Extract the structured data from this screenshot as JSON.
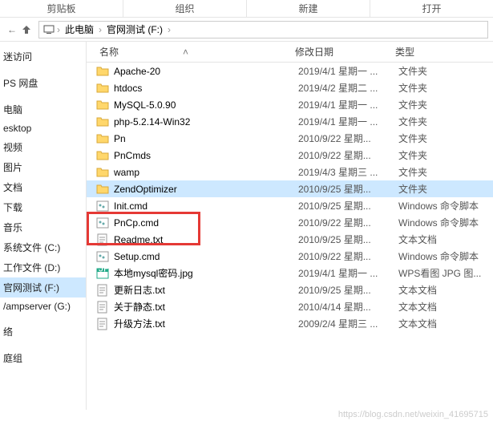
{
  "ribbon": {
    "clipboard": "剪贴板",
    "organize": "组织",
    "new": "新建",
    "open": "打开"
  },
  "nav": {
    "back": "←",
    "fwd": "→"
  },
  "breadcrumbs": [
    "此电脑",
    "官网测试 (F:)"
  ],
  "columns": {
    "name": "名称",
    "date": "修改日期",
    "type": "类型"
  },
  "sidebar": [
    {
      "label": "迷访问"
    },
    {
      "label": "PS 网盘"
    },
    {
      "label": "电脑"
    },
    {
      "label": "esktop"
    },
    {
      "label": "视频"
    },
    {
      "label": "图片"
    },
    {
      "label": "文档"
    },
    {
      "label": "下载"
    },
    {
      "label": "音乐"
    },
    {
      "label": "系统文件 (C:)"
    },
    {
      "label": "工作文件 (D:)"
    },
    {
      "label": "官网测试 (F:)",
      "selected": true
    },
    {
      "label": "/ampserver (G:)"
    },
    {
      "label": "络"
    },
    {
      "label": "庭组"
    }
  ],
  "files": [
    {
      "icon": "folder",
      "name": "Apache-20",
      "date": "2019/4/1 星期一 ...",
      "type": "文件夹"
    },
    {
      "icon": "folder",
      "name": "htdocs",
      "date": "2019/4/2 星期二 ...",
      "type": "文件夹"
    },
    {
      "icon": "folder",
      "name": "MySQL-5.0.90",
      "date": "2019/4/1 星期一 ...",
      "type": "文件夹"
    },
    {
      "icon": "folder",
      "name": "php-5.2.14-Win32",
      "date": "2019/4/1 星期一 ...",
      "type": "文件夹"
    },
    {
      "icon": "folder",
      "name": "Pn",
      "date": "2010/9/22 星期...",
      "type": "文件夹"
    },
    {
      "icon": "folder",
      "name": "PnCmds",
      "date": "2010/9/22 星期...",
      "type": "文件夹"
    },
    {
      "icon": "folder",
      "name": "wamp",
      "date": "2019/4/3 星期三 ...",
      "type": "文件夹"
    },
    {
      "icon": "folder",
      "name": "ZendOptimizer",
      "date": "2010/9/25 星期...",
      "type": "文件夹",
      "selected": true
    },
    {
      "icon": "cmd",
      "name": "Init.cmd",
      "date": "2010/9/25 星期...",
      "type": "Windows 命令脚本"
    },
    {
      "icon": "cmd",
      "name": "PnCp.cmd",
      "date": "2010/9/22 星期...",
      "type": "Windows 命令脚本"
    },
    {
      "icon": "txt",
      "name": "Readme.txt",
      "date": "2010/9/25 星期...",
      "type": "文本文档"
    },
    {
      "icon": "cmd",
      "name": "Setup.cmd",
      "date": "2010/9/22 星期...",
      "type": "Windows 命令脚本"
    },
    {
      "icon": "jpg",
      "name": "本地mysql密码.jpg",
      "date": "2019/4/1 星期一 ...",
      "type": "WPS看图 JPG 图..."
    },
    {
      "icon": "txt",
      "name": "更新日志.txt",
      "date": "2010/9/25 星期...",
      "type": "文本文档"
    },
    {
      "icon": "txt",
      "name": "关于静态.txt",
      "date": "2010/4/14 星期...",
      "type": "文本文档"
    },
    {
      "icon": "txt",
      "name": "升级方法.txt",
      "date": "2009/2/4 星期三 ...",
      "type": "文本文档"
    }
  ],
  "watermark": "https://blog.csdn.net/weixin_41695715"
}
